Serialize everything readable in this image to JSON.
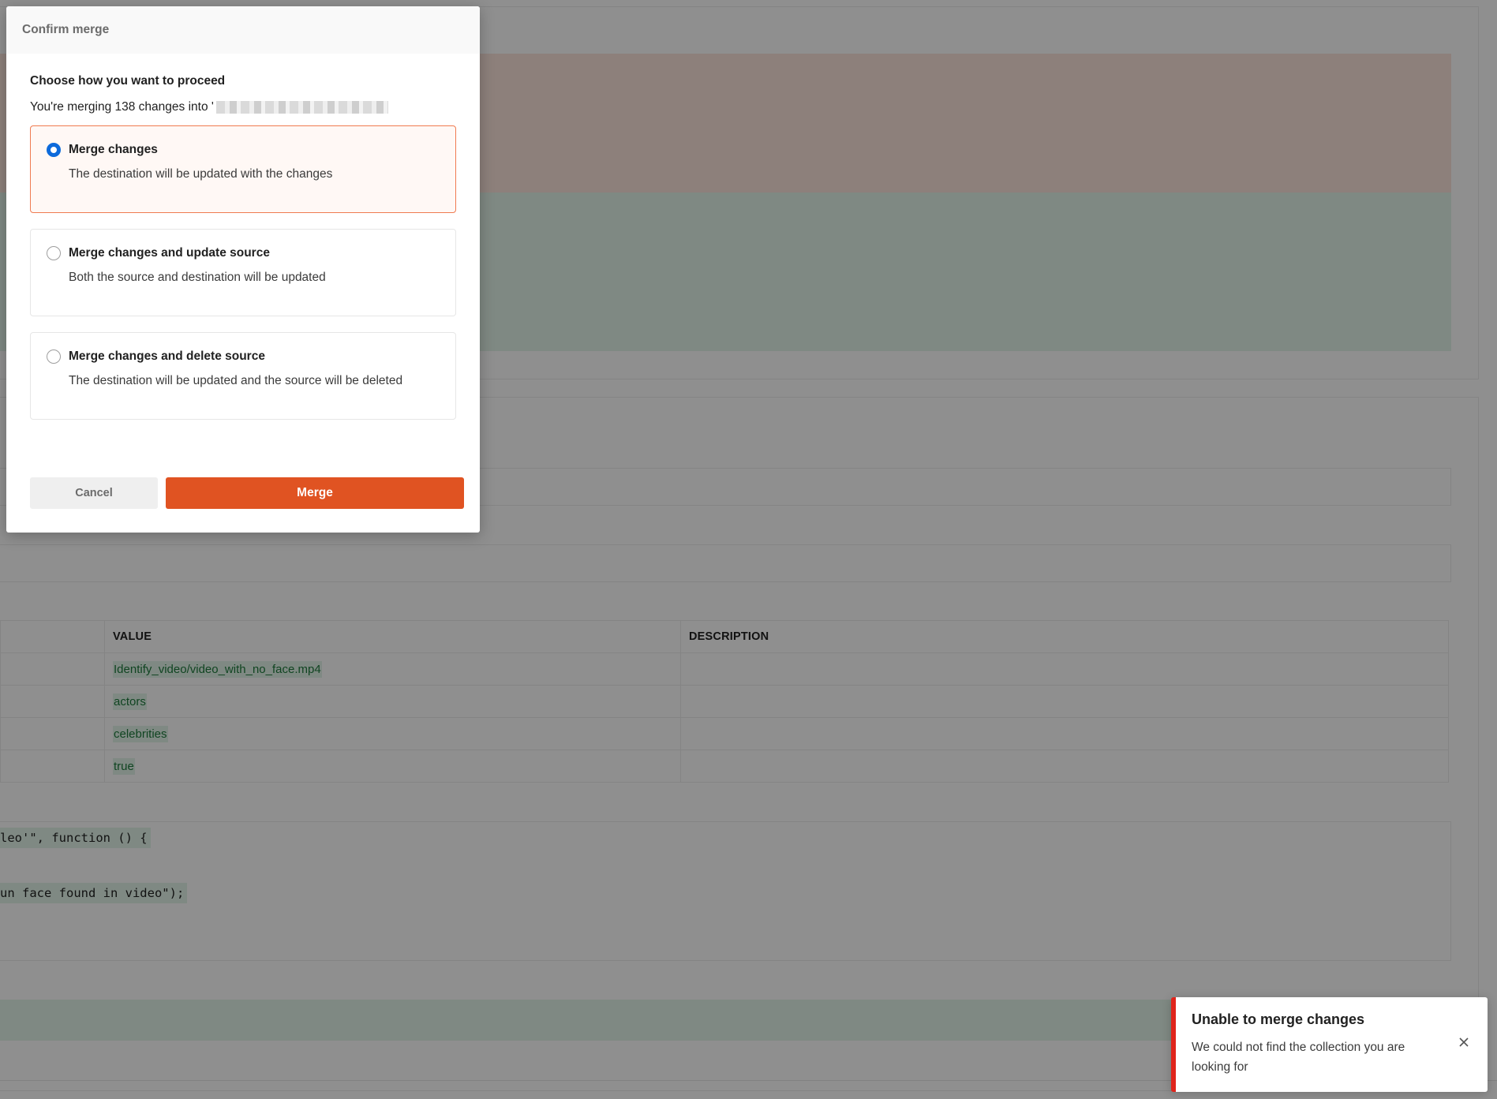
{
  "modal": {
    "title": "Confirm merge",
    "heading": "Choose how you want to proceed",
    "subline": "You're merging 138 changes into '",
    "options": [
      {
        "title": "Merge changes",
        "description": "The destination will be updated with the changes",
        "selected": true
      },
      {
        "title": "Merge changes and update source",
        "description": "Both the source and destination will be updated",
        "selected": false
      },
      {
        "title": "Merge changes and delete source",
        "description": "The destination will be updated and the source will be deleted",
        "selected": false
      }
    ],
    "cancel_label": "Cancel",
    "merge_label": "Merge"
  },
  "background": {
    "table": {
      "headers": [
        "VALUE",
        "DESCRIPTION"
      ],
      "rows": [
        {
          "value": "Identify_video/video_with_no_face.mp4",
          "description": ""
        },
        {
          "value": "actors",
          "description": ""
        },
        {
          "value": "celebrities",
          "description": ""
        },
        {
          "value": "true",
          "description": ""
        }
      ]
    },
    "code_lines": [
      "leo'\", function () {",
      "un face found in video\");"
    ]
  },
  "toast": {
    "title": "Unable to merge changes",
    "message": "We could not find the collection you are looking for",
    "accent_color": "#e0241b"
  },
  "colors": {
    "accent": "#e05322",
    "radio_selected": "#0d6adb",
    "diff_added": "#e2f5ea",
    "diff_removed": "#fbe4dc"
  }
}
